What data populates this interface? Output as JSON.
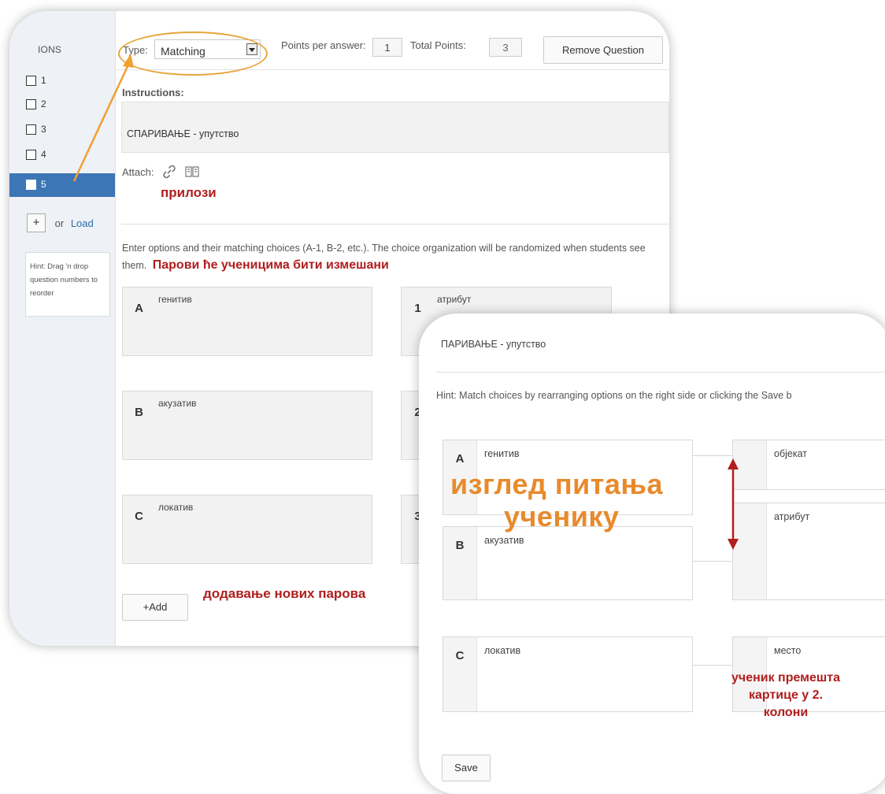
{
  "editor": {
    "sidebar": {
      "title": "IONS",
      "questions": [
        {
          "label": "1"
        },
        {
          "label": "2"
        },
        {
          "label": "3"
        },
        {
          "label": "4"
        },
        {
          "label": "5"
        }
      ],
      "add_label": "+",
      "or_label": "or",
      "load_label": "Load",
      "hint": "Hint: Drag 'n drop question numbers to reorder"
    },
    "toolbar": {
      "type_label": "Type:",
      "type_value": "Matching",
      "points_per_answer_label": "Points per answer:",
      "points_per_answer_value": "1",
      "total_points_label": "Total Points:",
      "total_points_value": "3",
      "remove_button": "Remove Question"
    },
    "instructions_label": "Instructions:",
    "instructions_text": "СПАРИВАЊЕ - упутство",
    "attach_label": "Attach:",
    "attach_note": "прилози",
    "options_text": "Enter options and their matching choices (A-1, B-2, etc.). The choice organization will be randomized when students see them.",
    "options_note": "Парови ће ученицима бити измешани",
    "pairs": [
      {
        "letter": "A",
        "option": "генитив",
        "number": "1",
        "choice": "атрибут"
      },
      {
        "letter": "B",
        "option": "акузатив",
        "number": "2",
        "choice": ""
      },
      {
        "letter": "C",
        "option": "локатив",
        "number": "3",
        "choice": ""
      }
    ],
    "add_button": "+Add",
    "add_note": "додавање нових парова"
  },
  "preview": {
    "instructions_text": "ПАРИВАЊЕ - упутство",
    "hint": "Hint: Match choices by rearranging options on the right side or clicking the Save b",
    "left": [
      {
        "letter": "A",
        "text": "генитив"
      },
      {
        "letter": "B",
        "text": "акузатив"
      },
      {
        "letter": "C",
        "text": "локатив"
      }
    ],
    "right": [
      {
        "text": "објекат"
      },
      {
        "text": "атрибут"
      },
      {
        "text": "место"
      }
    ],
    "title_line1": "изглед питања",
    "title_line2": "ученику",
    "move_note_line1": "ученик премешта",
    "move_note_line2": "картице у 2.",
    "move_note_line3": "колони",
    "save_button": "Save"
  },
  "colors": {
    "accent_blue": "#3d76b6",
    "annotation_red": "#b01e1e",
    "annotation_orange": "#e88a2c",
    "highlight_ring": "#e8a43a"
  }
}
